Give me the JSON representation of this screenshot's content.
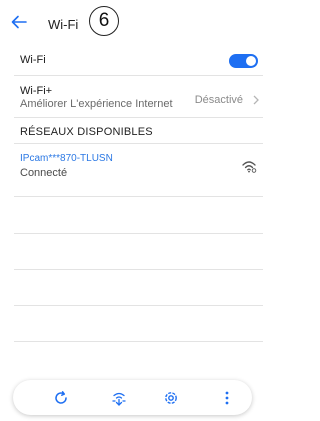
{
  "header": {
    "title": "Wi-Fi",
    "step": "6"
  },
  "wifi": {
    "label": "Wi-Fi",
    "enabled": true
  },
  "wifi_plus": {
    "title": "Wi-Fi+",
    "subtitle": "Améliorer L'expérience Internet",
    "value": "Désactivé"
  },
  "available": {
    "header": "RÉSEAUX DISPONIBLES",
    "networks": [
      {
        "name": "IPcam***870-TLUSN",
        "status": "Connecté",
        "icon": "wifi-signal-icon"
      }
    ]
  },
  "bottom_bar": {
    "buttons": [
      "refresh-icon",
      "wps-icon",
      "settings-icon",
      "more-icon"
    ]
  },
  "colors": {
    "accent": "#1e6ff2",
    "network_name": "#2b78e4"
  }
}
